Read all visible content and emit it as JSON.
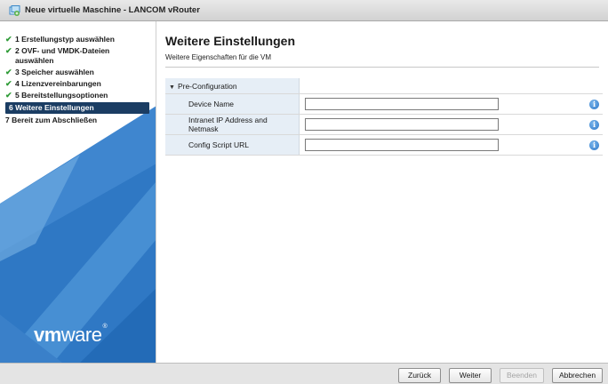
{
  "window": {
    "title": "Neue virtuelle Maschine - LANCOM vRouter"
  },
  "nav": {
    "steps": [
      {
        "label": "1 Erstellungstyp auswählen",
        "state": "done"
      },
      {
        "label": "2 OVF- und VMDK-Dateien auswählen",
        "state": "done"
      },
      {
        "label": "3 Speicher auswählen",
        "state": "done"
      },
      {
        "label": "4 Lizenzvereinbarungen",
        "state": "done"
      },
      {
        "label": "5 Bereitstellungsoptionen",
        "state": "done"
      },
      {
        "label": "6 Weitere Einstellungen",
        "state": "active"
      },
      {
        "label": "7 Bereit zum Abschließen",
        "state": "pending"
      }
    ],
    "logo": {
      "vm": "vm",
      "ware": "ware",
      "reg": "®"
    }
  },
  "main": {
    "title": "Weitere Einstellungen",
    "subtitle": "Weitere Eigenschaften für die VM",
    "section": "Pre-Configuration",
    "fields": [
      {
        "label": "Device Name",
        "value": ""
      },
      {
        "label": "Intranet IP Address and Netmask",
        "value": ""
      },
      {
        "label": "Config Script URL",
        "value": ""
      }
    ],
    "info_icon": "i"
  },
  "footer": {
    "back": "Zurück",
    "next": "Weiter",
    "finish": "Beenden",
    "cancel": "Abbrechen"
  },
  "colors": {
    "active_step": "#1b3d63",
    "check": "#2e9b36",
    "label_bg": "#e6eef6",
    "nav_blue": "#2a6ebd"
  }
}
